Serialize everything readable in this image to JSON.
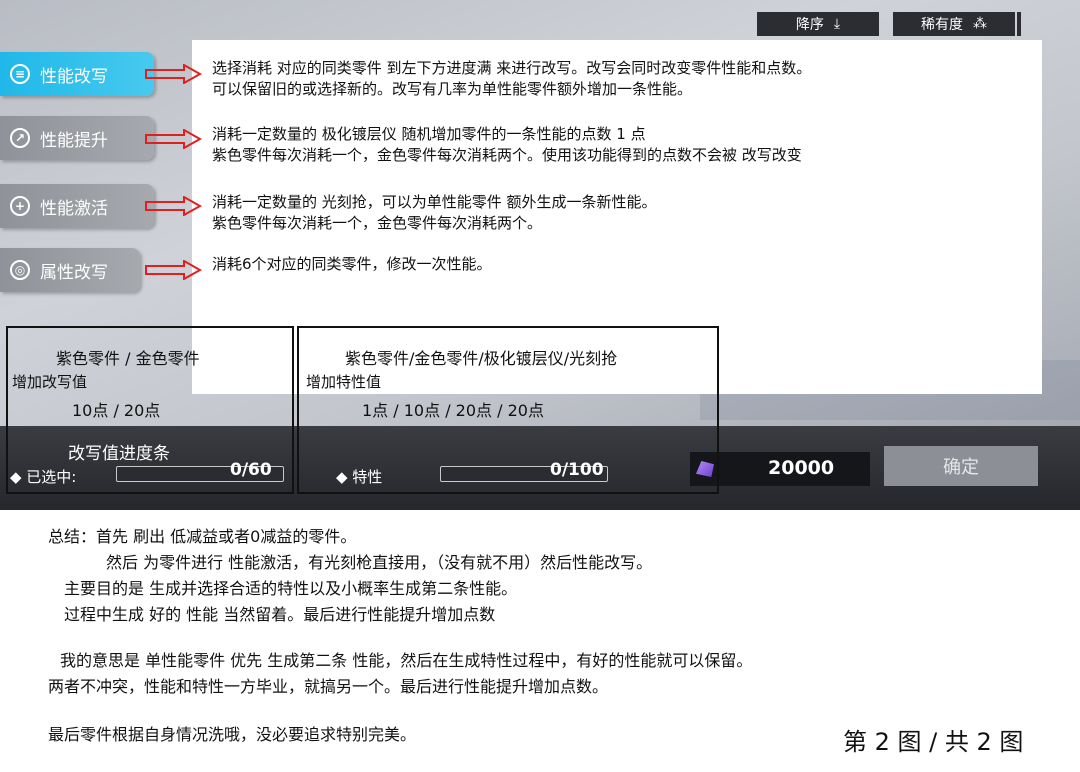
{
  "sort": {
    "order_label": "降序",
    "rarity_label": "稀有度"
  },
  "tabs": [
    {
      "label": "性能改写",
      "icon": "rewrite-icon",
      "active": true
    },
    {
      "label": "性能提升",
      "icon": "upgrade-icon",
      "active": false
    },
    {
      "label": "性能激活",
      "icon": "activate-icon",
      "active": false
    },
    {
      "label": "属性改写",
      "icon": "attribute-icon",
      "active": false
    }
  ],
  "notes": {
    "rewrite": [
      "选择消耗 对应的同类零件 到左下方进度满 来进行改写。改写会同时改变零件性能和点数。",
      "可以保留旧的或选择新的。改写有几率为单性能零件额外增加一条性能。"
    ],
    "upgrade": [
      "消耗一定数量的 极化镀层仪 随机增加零件的一条性能的点数 1 点",
      "紫色零件每次消耗一个，金色零件每次消耗两个。使用该功能得到的点数不会被 改写改变"
    ],
    "activate": [
      "消耗一定数量的 光刻抢，可以为单性能零件 额外生成一条新性能。",
      "紫色零件每次消耗一个，金色零件每次消耗两个。"
    ],
    "attribute": [
      "消耗6个对应的同类零件，修改一次性能。"
    ]
  },
  "box_left": {
    "header": "紫色零件 /   金色零件",
    "sub": "增加改写值",
    "values": "10点    /       20点",
    "caption": "改写值进度条"
  },
  "box_mid": {
    "header": "紫色零件/金色零件/极化镀层仪/光刻抢",
    "sub": "增加特性值",
    "values": "1点     /    10点   /     20点      /  20点"
  },
  "bottom_bar": {
    "selected_label": "◆ 已选中:",
    "selected_value": "0/60",
    "trait_label": "◆ 特性",
    "trait_value": "0/100",
    "currency_value": "20000",
    "confirm_label": "确定"
  },
  "summary": {
    "line1": "总结：首先 刷出 低减益或者0减益的零件。",
    "line2": "然后 为零件进行 性能激活，有光刻枪直接用，（没有就不用）然后性能改写。",
    "line3": "主要目的是 生成并选择合适的特性以及小概率生成第二条性能。",
    "line4": "过程中生成 好的 性能 当然留着。最后进行性能提升增加点数",
    "line5": "我的意思是 单性能零件 优先 生成第二条 性能，然后在生成特性过程中，有好的性能就可以保留。",
    "line6": "两者不冲突，性能和特性一方毕业，就搞另一个。最后进行性能提升增加点数。",
    "line7": "最后零件根据自身情况洗哦，没必要追求特别完美。"
  },
  "page_indicator": "第 2 图 / 共 2 图",
  "colors": {
    "active_tab": "#1fb8e8",
    "arrow": "#e0201f",
    "bar": "#2b2d33"
  }
}
